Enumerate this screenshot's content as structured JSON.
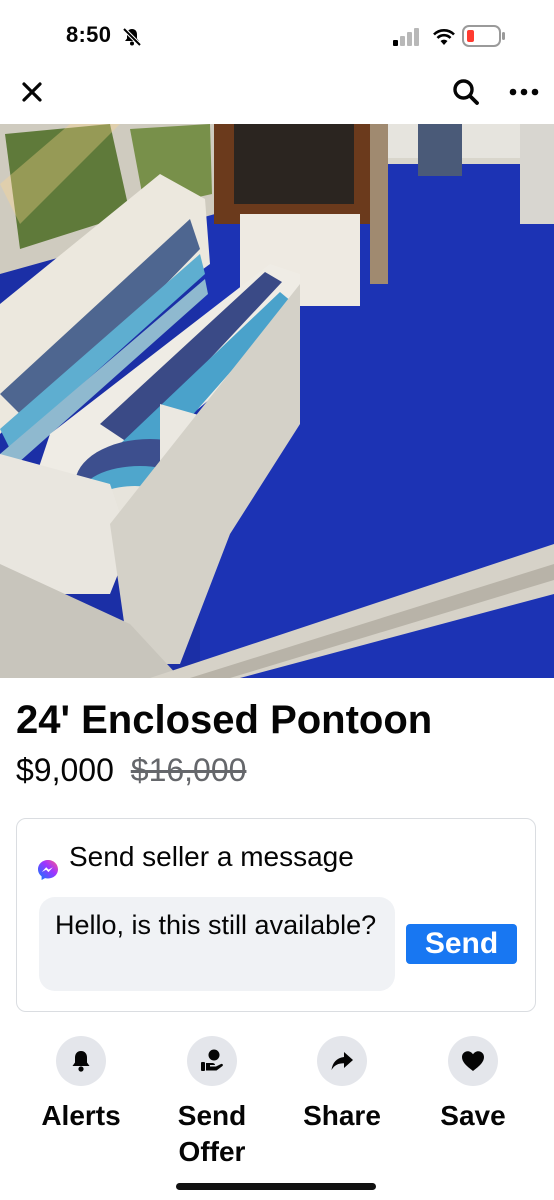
{
  "status_bar": {
    "time": "8:50",
    "icons": [
      "bell-slash-icon",
      "cellular-signal-icon",
      "wifi-icon",
      "battery-low-icon"
    ],
    "battery_color": "#ff3b30"
  },
  "nav": {
    "icons": [
      "close-icon",
      "search-icon",
      "more-icon"
    ]
  },
  "photo": {
    "dots_total": 5,
    "active_dot": 3,
    "colors": {
      "carpet": "#1a2ea8",
      "seat": "#e8e6df"
    }
  },
  "listing": {
    "title": "24' Enclosed Pontoon",
    "price": "$9,000",
    "original_price": "$16,000"
  },
  "message_card": {
    "icon": "messenger-icon",
    "title": "Send seller a message",
    "input_value": "Hello, is this still available?",
    "send_label": "Send"
  },
  "actions": [
    {
      "label": "Alerts",
      "icon": "bell-icon"
    },
    {
      "label": "Send Offer",
      "icon": "offer-hand-icon"
    },
    {
      "label": "Share",
      "icon": "share-arrow-icon"
    },
    {
      "label": "Save",
      "icon": "heart-icon"
    }
  ],
  "colors": {
    "accent": "#1877f2",
    "text": "#050505",
    "muted": "#65676b",
    "button_bg": "#e4e6eb"
  }
}
